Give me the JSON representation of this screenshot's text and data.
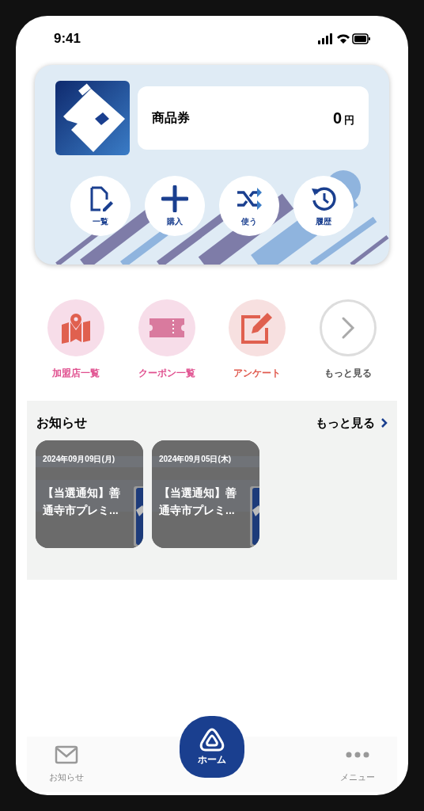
{
  "status_bar": {
    "time": "9:41"
  },
  "wallet": {
    "label": "商品券",
    "amount": "0",
    "unit": "円",
    "actions": [
      {
        "kind": "list",
        "label": "一覧"
      },
      {
        "kind": "buy",
        "label": "購入"
      },
      {
        "kind": "use",
        "label": "使う"
      },
      {
        "kind": "history",
        "label": "履歴"
      }
    ]
  },
  "shortcuts": [
    {
      "kind": "map",
      "label": "加盟店一覧",
      "color": "#e0508f"
    },
    {
      "kind": "coupon",
      "label": "クーポン一覧",
      "color": "#e0508f"
    },
    {
      "kind": "survey",
      "label": "アンケート",
      "color": "#e05a4e"
    },
    {
      "kind": "more",
      "label": "もっと見る",
      "color": "#555555"
    }
  ],
  "news": {
    "title": "お知らせ",
    "more": "もっと見る",
    "items": [
      {
        "date": "2024年09月09日(月)",
        "title": "【当選通知】善通寺市プレミ..."
      },
      {
        "date": "2024年09月05日(木)",
        "title": "【当選通知】善通寺市プレミ..."
      }
    ]
  },
  "tab_bar": {
    "items": [
      {
        "kind": "mail",
        "label": "お知らせ",
        "selected": false
      },
      {
        "kind": "home",
        "label": "ホーム",
        "selected": true
      },
      {
        "kind": "menu",
        "label": "メニュー",
        "selected": false
      }
    ]
  }
}
